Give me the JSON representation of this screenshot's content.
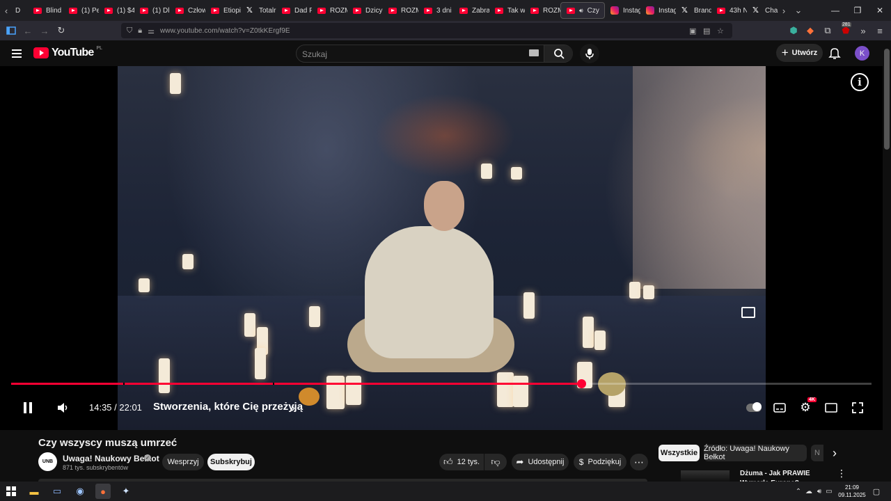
{
  "browser": {
    "tabs": [
      {
        "label": "D",
        "icon": "back-arrow"
      },
      {
        "label": "Blind",
        "icon": "youtube"
      },
      {
        "label": "(1) Pe",
        "icon": "youtube"
      },
      {
        "label": "(1) $4",
        "icon": "youtube"
      },
      {
        "label": "(1) Dl",
        "icon": "youtube"
      },
      {
        "label": "Człow",
        "icon": "youtube"
      },
      {
        "label": "Etiopi",
        "icon": "youtube"
      },
      {
        "label": "Totalr",
        "icon": "x"
      },
      {
        "label": "Dad P",
        "icon": "youtube"
      },
      {
        "label": "ROZM",
        "icon": "youtube"
      },
      {
        "label": "Dzicy",
        "icon": "youtube"
      },
      {
        "label": "ROZM",
        "icon": "youtube"
      },
      {
        "label": "3 dni",
        "icon": "youtube"
      },
      {
        "label": "Zabra",
        "icon": "youtube"
      },
      {
        "label": "Tak w",
        "icon": "youtube"
      },
      {
        "label": "ROZM",
        "icon": "youtube"
      },
      {
        "label": "Czy",
        "icon": "youtube",
        "active": true
      },
      {
        "label": "Instag",
        "icon": "instagram"
      },
      {
        "label": "Instag",
        "icon": "instagram"
      },
      {
        "label": "Brand",
        "icon": "x"
      },
      {
        "label": "43h N",
        "icon": "youtube"
      },
      {
        "label": "Cha",
        "icon": "x"
      }
    ],
    "url": "www.youtube.com/watch?v=Z0tkKErgf9E",
    "extension_badge": "281"
  },
  "youtube": {
    "logo_text": "YouTube",
    "region": "PL",
    "search_placeholder": "Szukaj",
    "create_label": "Utwórz",
    "avatar_letter": "K"
  },
  "player": {
    "time": "14:35 / 22:01",
    "chapter": "Stworzenia, które Cię przeżyją",
    "quality_badge": "4K",
    "progress_fraction": 0.6625
  },
  "video": {
    "title": "Czy wszyscy muszą umrzeć",
    "channel": "Uwaga! Naukowy Bełkot",
    "channel_avatar_text": "UNB",
    "subscribers": "871 tys. subskrybentów",
    "support_label": "Wesprzyj",
    "subscribe_label": "Subskrybuj",
    "likes": "12 tys.",
    "share_label": "Udostępnij",
    "thanks_label": "Podziękuj"
  },
  "chips": [
    {
      "label": "Wszystkie",
      "active": true
    },
    {
      "label": "Źródło: Uwaga! Naukowy Bełkot",
      "active": false
    },
    {
      "label": "N",
      "active": false
    }
  ],
  "recommendation": {
    "title": "Dżuma - Jak PRAWIE Wymarła Europa?"
  },
  "taskbar": {
    "time": "21:09",
    "date": "09.11.2025"
  },
  "colors": {
    "accent": "#ff0033",
    "background": "#0f0f0f"
  }
}
